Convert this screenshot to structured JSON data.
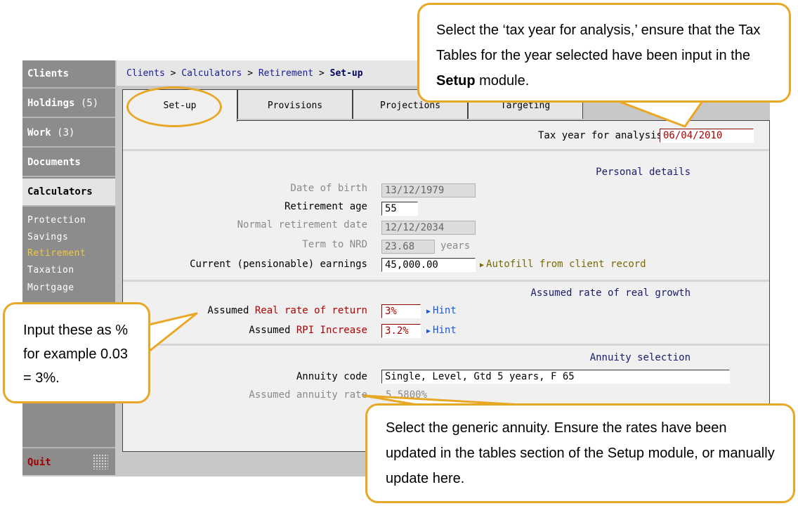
{
  "sidebar": {
    "items": [
      {
        "label": "Clients",
        "count": ""
      },
      {
        "label": "Holdings",
        "count": " (5)"
      },
      {
        "label": "Work",
        "count": " (3)"
      },
      {
        "label": "Documents",
        "count": ""
      },
      {
        "label": "Calculators",
        "count": ""
      }
    ],
    "submenu": [
      "Protection",
      "Savings",
      "Retirement",
      "Taxation",
      "Mortgage"
    ],
    "active_submenu": "Retirement",
    "quit": "Quit"
  },
  "breadcrumb": {
    "items": [
      "Clients",
      "Calculators",
      "Retirement"
    ],
    "separator": " > ",
    "current": "Set-up"
  },
  "tabs": [
    "Set-up",
    "Provisions",
    "Projections",
    "Targeting"
  ],
  "active_tab": "Set-up",
  "form": {
    "tax_year_label": "Tax year for analysis",
    "tax_year_value": "06/04/2010",
    "personal_section": "Personal details",
    "dob_label": "Date of birth",
    "dob_value": "13/12/1979",
    "retirement_age_label": "Retirement age",
    "retirement_age_value": "55",
    "nrd_label": "Normal retirement date",
    "nrd_value": "12/12/2034",
    "term_label": "Term to NRD",
    "term_value": "23.68",
    "term_unit": "years",
    "earnings_label": "Current (pensionable) earnings",
    "earnings_value": "45,000.00",
    "autofill_link": "Autofill from client record",
    "growth_section": "Assumed rate of real growth",
    "real_return_prefix": "Assumed ",
    "real_return_label": "Real rate of return",
    "real_return_value": "3%",
    "rpi_prefix": "Assumed ",
    "rpi_label": "RPI Increase",
    "rpi_value": "3.2%",
    "hint": "Hint",
    "annuity_section": "Annuity selection",
    "annuity_code_label": "Annuity code",
    "annuity_code_value": "Single, Level, Gtd 5 years, F 65",
    "annuity_rate_label": "Assumed annuity rate",
    "annuity_rate_value": "5.5800%"
  },
  "callouts": {
    "tax_year_pre": "Select the ‘tax year for analysis,’ ensure that the Tax Tables for the year selected have been input in the ",
    "tax_year_bold": "Setup",
    "tax_year_post": " module.",
    "percent": "Input these as % for example 0.03 = 3%.",
    "annuity": "Select the generic annuity. Ensure the rates have been updated in the tables section of the Setup module, or manually update here."
  },
  "colors": {
    "callout_border": "#e8a825",
    "sidebar": "#8c8c8c",
    "active_submenu": "#f0c840",
    "quit": "#a00000",
    "link_blue": "#1a5ad8",
    "error_red": "#b00000"
  }
}
